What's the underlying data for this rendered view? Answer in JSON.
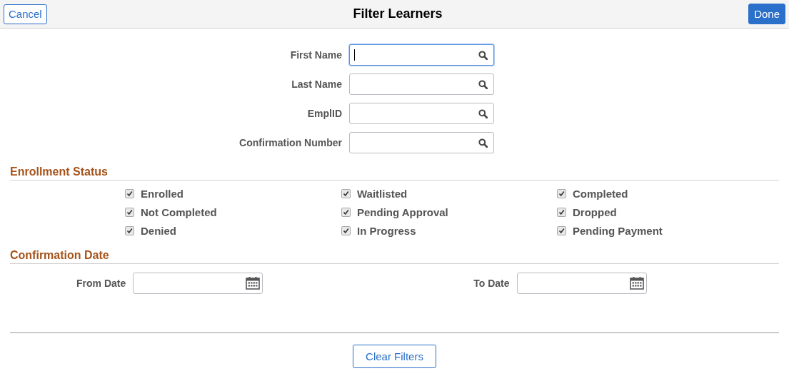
{
  "header": {
    "cancel": "Cancel",
    "title": "Filter Learners",
    "done": "Done"
  },
  "fields": [
    {
      "label": "First Name",
      "focused": true
    },
    {
      "label": "Last Name",
      "focused": false
    },
    {
      "label": "EmplID",
      "focused": false
    },
    {
      "label": "Confirmation Number",
      "focused": false
    }
  ],
  "enrollment_status": {
    "title": "Enrollment Status",
    "options": [
      {
        "label": "Enrolled",
        "checked": true
      },
      {
        "label": "Waitlisted",
        "checked": true
      },
      {
        "label": "Completed",
        "checked": true
      },
      {
        "label": "Not Completed",
        "checked": true
      },
      {
        "label": "Pending Approval",
        "checked": true
      },
      {
        "label": "Dropped",
        "checked": true
      },
      {
        "label": "Denied",
        "checked": true
      },
      {
        "label": "In Progress",
        "checked": true
      },
      {
        "label": "Pending Payment",
        "checked": true
      }
    ]
  },
  "confirmation_date": {
    "title": "Confirmation Date",
    "from_label": "From Date",
    "to_label": "To Date"
  },
  "clear_button": "Clear Filters"
}
